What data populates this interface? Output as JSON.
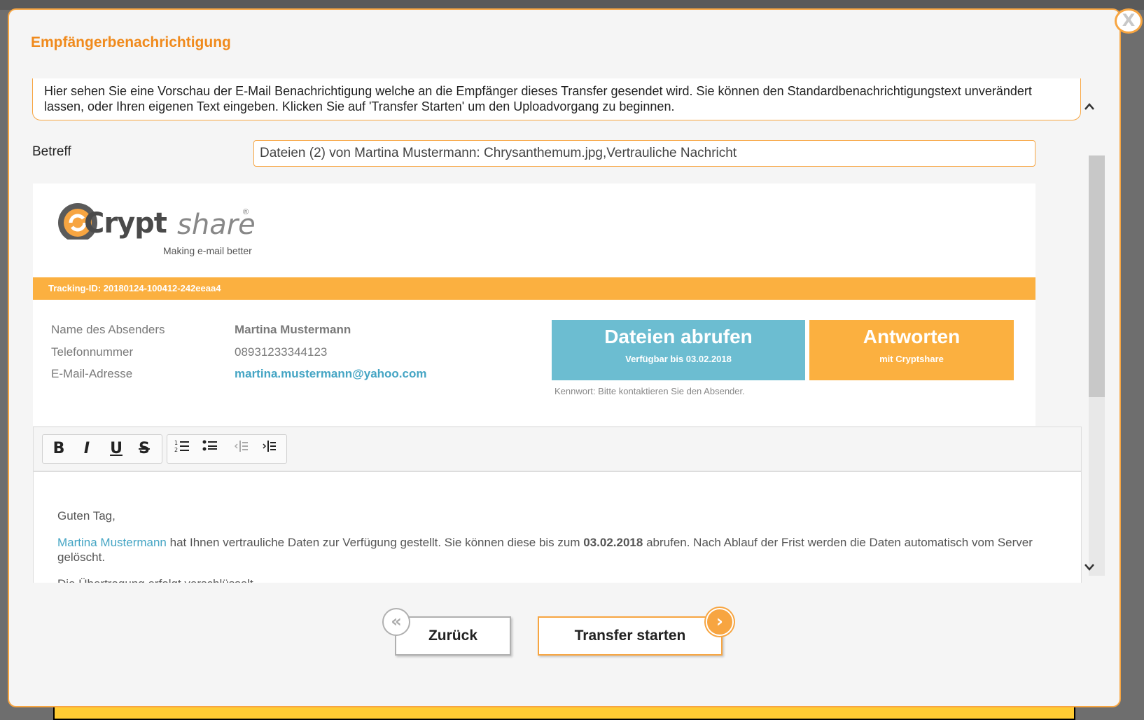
{
  "dialog": {
    "title": "Empfängerbenachrichtigung",
    "close_label": "X",
    "info_text": "Hier sehen Sie eine Vorschau der E-Mail Benachrichtigung welche an die Empfänger dieses Transfer gesendet wird. Sie können den Standardbenachrichtigungstext unverändert lassen, oder Ihren eigenen Text eingeben. Klicken Sie auf 'Transfer Starten' um den Uploadvorgang zu beginnen."
  },
  "subject": {
    "label": "Betreff",
    "value": "Dateien (2) von Martina Mustermann: Chrysanthemum.jpg,Vertrauliche Nachricht"
  },
  "preview": {
    "logo_crypt": "Crypt",
    "logo_share": "share",
    "logo_reg": "®",
    "logo_tagline": "Making e-mail better",
    "tracking": "Tracking-ID: 20180124-100412-242eeaa4",
    "sender_fields": [
      {
        "label": "Name des Absenders",
        "value": "Martina Mustermann"
      },
      {
        "label": "Telefonnummer",
        "value": "08931233344123"
      },
      {
        "label": "E-Mail-Adresse",
        "value": "martina.mustermann@yahoo.com"
      }
    ],
    "retrieve_button": {
      "title": "Dateien abrufen",
      "subtitle": "Verfügbar bis 03.02.2018"
    },
    "reply_button": {
      "title": "Antworten",
      "subtitle": "mit Cryptshare"
    },
    "password_note": "Kennwort: Bitte kontaktieren Sie den Absender."
  },
  "toolbar": {
    "bold": "B",
    "italic": "I",
    "underline": "U",
    "strike": "S",
    "ordered_list": "⒈",
    "bullet_list": "•",
    "outdent": "⇤",
    "indent": "⇥"
  },
  "editor": {
    "greeting": "Guten Tag,",
    "sender_link": "Martina Mustermann",
    "body_part1": " hat Ihnen vertrauliche Daten zur Verfügung gestellt. Sie können diese bis zum ",
    "date": "03.02.2018",
    "body_part2": " abrufen. Nach Ablauf der Frist werden die Daten automatisch vom Server gelöscht.",
    "line3": "Die Übertragung erfolgt verschlüsselt."
  },
  "navigation": {
    "back_label": "Zurück",
    "start_label": "Transfer starten"
  },
  "colors": {
    "accent": "#f7a541",
    "tracking_bar": "#fbb040",
    "retrieve_button": "#6cbdd1",
    "link": "#45a5c4"
  }
}
